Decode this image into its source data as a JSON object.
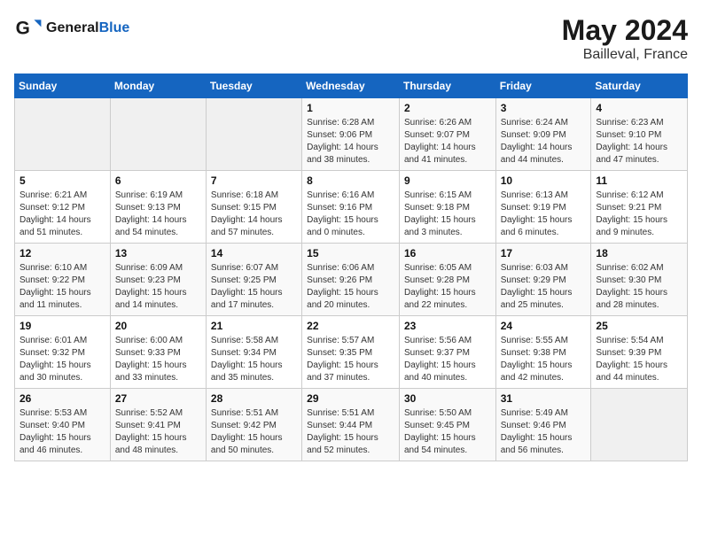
{
  "header": {
    "logo_general": "General",
    "logo_blue": "Blue",
    "title": "May 2024",
    "location": "Bailleval, France"
  },
  "calendar": {
    "days_of_week": [
      "Sunday",
      "Monday",
      "Tuesday",
      "Wednesday",
      "Thursday",
      "Friday",
      "Saturday"
    ],
    "weeks": [
      [
        {
          "day": "",
          "content": ""
        },
        {
          "day": "",
          "content": ""
        },
        {
          "day": "",
          "content": ""
        },
        {
          "day": "1",
          "content": "Sunrise: 6:28 AM\nSunset: 9:06 PM\nDaylight: 14 hours\nand 38 minutes."
        },
        {
          "day": "2",
          "content": "Sunrise: 6:26 AM\nSunset: 9:07 PM\nDaylight: 14 hours\nand 41 minutes."
        },
        {
          "day": "3",
          "content": "Sunrise: 6:24 AM\nSunset: 9:09 PM\nDaylight: 14 hours\nand 44 minutes."
        },
        {
          "day": "4",
          "content": "Sunrise: 6:23 AM\nSunset: 9:10 PM\nDaylight: 14 hours\nand 47 minutes."
        }
      ],
      [
        {
          "day": "5",
          "content": "Sunrise: 6:21 AM\nSunset: 9:12 PM\nDaylight: 14 hours\nand 51 minutes."
        },
        {
          "day": "6",
          "content": "Sunrise: 6:19 AM\nSunset: 9:13 PM\nDaylight: 14 hours\nand 54 minutes."
        },
        {
          "day": "7",
          "content": "Sunrise: 6:18 AM\nSunset: 9:15 PM\nDaylight: 14 hours\nand 57 minutes."
        },
        {
          "day": "8",
          "content": "Sunrise: 6:16 AM\nSunset: 9:16 PM\nDaylight: 15 hours\nand 0 minutes."
        },
        {
          "day": "9",
          "content": "Sunrise: 6:15 AM\nSunset: 9:18 PM\nDaylight: 15 hours\nand 3 minutes."
        },
        {
          "day": "10",
          "content": "Sunrise: 6:13 AM\nSunset: 9:19 PM\nDaylight: 15 hours\nand 6 minutes."
        },
        {
          "day": "11",
          "content": "Sunrise: 6:12 AM\nSunset: 9:21 PM\nDaylight: 15 hours\nand 9 minutes."
        }
      ],
      [
        {
          "day": "12",
          "content": "Sunrise: 6:10 AM\nSunset: 9:22 PM\nDaylight: 15 hours\nand 11 minutes."
        },
        {
          "day": "13",
          "content": "Sunrise: 6:09 AM\nSunset: 9:23 PM\nDaylight: 15 hours\nand 14 minutes."
        },
        {
          "day": "14",
          "content": "Sunrise: 6:07 AM\nSunset: 9:25 PM\nDaylight: 15 hours\nand 17 minutes."
        },
        {
          "day": "15",
          "content": "Sunrise: 6:06 AM\nSunset: 9:26 PM\nDaylight: 15 hours\nand 20 minutes."
        },
        {
          "day": "16",
          "content": "Sunrise: 6:05 AM\nSunset: 9:28 PM\nDaylight: 15 hours\nand 22 minutes."
        },
        {
          "day": "17",
          "content": "Sunrise: 6:03 AM\nSunset: 9:29 PM\nDaylight: 15 hours\nand 25 minutes."
        },
        {
          "day": "18",
          "content": "Sunrise: 6:02 AM\nSunset: 9:30 PM\nDaylight: 15 hours\nand 28 minutes."
        }
      ],
      [
        {
          "day": "19",
          "content": "Sunrise: 6:01 AM\nSunset: 9:32 PM\nDaylight: 15 hours\nand 30 minutes."
        },
        {
          "day": "20",
          "content": "Sunrise: 6:00 AM\nSunset: 9:33 PM\nDaylight: 15 hours\nand 33 minutes."
        },
        {
          "day": "21",
          "content": "Sunrise: 5:58 AM\nSunset: 9:34 PM\nDaylight: 15 hours\nand 35 minutes."
        },
        {
          "day": "22",
          "content": "Sunrise: 5:57 AM\nSunset: 9:35 PM\nDaylight: 15 hours\nand 37 minutes."
        },
        {
          "day": "23",
          "content": "Sunrise: 5:56 AM\nSunset: 9:37 PM\nDaylight: 15 hours\nand 40 minutes."
        },
        {
          "day": "24",
          "content": "Sunrise: 5:55 AM\nSunset: 9:38 PM\nDaylight: 15 hours\nand 42 minutes."
        },
        {
          "day": "25",
          "content": "Sunrise: 5:54 AM\nSunset: 9:39 PM\nDaylight: 15 hours\nand 44 minutes."
        }
      ],
      [
        {
          "day": "26",
          "content": "Sunrise: 5:53 AM\nSunset: 9:40 PM\nDaylight: 15 hours\nand 46 minutes."
        },
        {
          "day": "27",
          "content": "Sunrise: 5:52 AM\nSunset: 9:41 PM\nDaylight: 15 hours\nand 48 minutes."
        },
        {
          "day": "28",
          "content": "Sunrise: 5:51 AM\nSunset: 9:42 PM\nDaylight: 15 hours\nand 50 minutes."
        },
        {
          "day": "29",
          "content": "Sunrise: 5:51 AM\nSunset: 9:44 PM\nDaylight: 15 hours\nand 52 minutes."
        },
        {
          "day": "30",
          "content": "Sunrise: 5:50 AM\nSunset: 9:45 PM\nDaylight: 15 hours\nand 54 minutes."
        },
        {
          "day": "31",
          "content": "Sunrise: 5:49 AM\nSunset: 9:46 PM\nDaylight: 15 hours\nand 56 minutes."
        },
        {
          "day": "",
          "content": ""
        }
      ]
    ]
  }
}
